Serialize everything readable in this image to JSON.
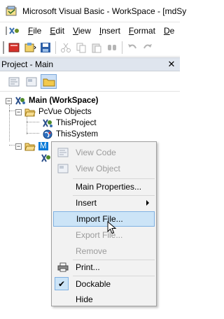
{
  "window": {
    "title": "Microsoft Visual Basic - WorkSpace - [mdSy"
  },
  "menu": {
    "items": [
      {
        "id": "file",
        "label": "File",
        "mnemonic": "F",
        "rest": "ile"
      },
      {
        "id": "edit",
        "label": "Edit",
        "mnemonic": "E",
        "rest": "dit"
      },
      {
        "id": "view",
        "label": "View",
        "mnemonic": "V",
        "rest": "iew"
      },
      {
        "id": "insert",
        "label": "Insert",
        "mnemonic": "I",
        "rest": "nsert"
      },
      {
        "id": "format",
        "label": "Format",
        "mnemonic": "F",
        "rest": "ormat"
      },
      {
        "id": "debug",
        "label": "De",
        "mnemonic": "D",
        "rest": "e"
      }
    ]
  },
  "project_pane": {
    "title": "Project - Main",
    "close_glyph": "✕",
    "tree": {
      "root": "Main (WorkSpace)",
      "folder": "PcVue Objects",
      "child1": "ThisProject",
      "child2": "ThisSystem",
      "selected_partial": "M"
    }
  },
  "context_menu": {
    "view_code": "View Code",
    "view_object": "View Object",
    "main_properties": "Main Properties...",
    "insert": "Insert",
    "import_file": "Import File...",
    "export_file": "Export File...",
    "remove": "Remove",
    "print": "Print...",
    "dockable": "Dockable",
    "hide": "Hide",
    "check_glyph": "✔"
  },
  "colors": {
    "hover": "#cce4f7",
    "selection": "#0078d7",
    "pane_header": "#dfe5ee",
    "menu_bg": "#f2f2f2"
  }
}
